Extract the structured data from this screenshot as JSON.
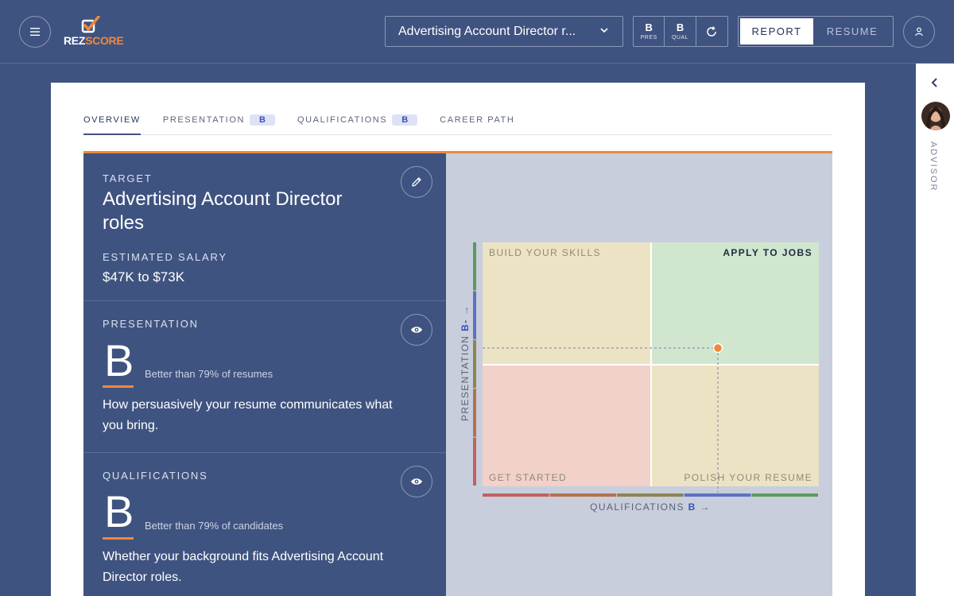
{
  "app": {
    "logo_text_rez": "REZ",
    "logo_text_score": "SCORE"
  },
  "header": {
    "target_select_value": "Advertising Account Director r...",
    "grades": [
      {
        "grade": "B",
        "label": "PRES"
      },
      {
        "grade": "B",
        "label": "QUAL"
      }
    ],
    "view_report": "REPORT",
    "view_resume": "RESUME"
  },
  "advisor": {
    "label": "ADVISOR"
  },
  "tabs": [
    {
      "label": "OVERVIEW",
      "active": true
    },
    {
      "label": "PRESENTATION",
      "badge": "B"
    },
    {
      "label": "QUALIFICATIONS",
      "badge": "B"
    },
    {
      "label": "CAREER PATH"
    }
  ],
  "target": {
    "eyebrow": "TARGET",
    "title": "Advertising Account Director roles",
    "salary_label": "ESTIMATED SALARY",
    "salary_value": "$47K to $73K"
  },
  "presentation": {
    "eyebrow": "PRESENTATION",
    "grade": "B",
    "better_than": "Better than 79% of resumes",
    "description": "How persuasively your resume communicates what you bring."
  },
  "qualifications": {
    "eyebrow": "QUALIFICATIONS",
    "grade": "B",
    "better_than": "Better than 79% of candidates",
    "description": "Whether your background fits Advertising Account Director roles."
  },
  "quadrant": {
    "top_left": "BUILD YOUR SKILLS",
    "top_right": "APPLY TO JOBS",
    "bottom_left": "GET STARTED",
    "bottom_right": "POLISH YOUR RESUME",
    "y_axis_label": "PRESENTATION",
    "y_axis_grade": "B-",
    "x_axis_label": "QUALIFICATIONS",
    "x_axis_grade": "B",
    "colors": {
      "top_left": "#ece3c4",
      "top_right": "#d1e6cf",
      "bottom_left": "#f1d1ca",
      "bottom_right": "#ece3c4",
      "marker": "#f0883a"
    },
    "grade_band_colors": [
      "#c0625c",
      "#b3734a",
      "#8c8452",
      "#5c72c0",
      "#5c9a5c"
    ]
  }
}
